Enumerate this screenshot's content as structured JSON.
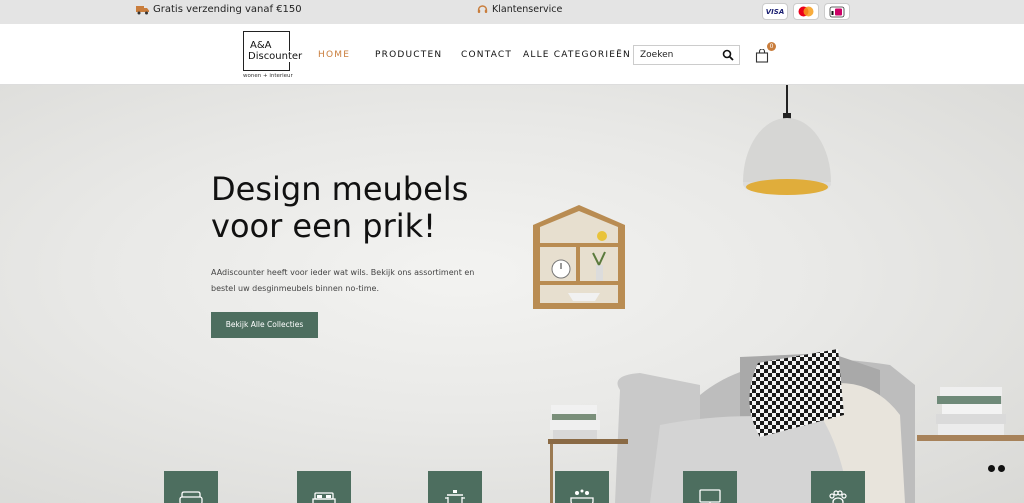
{
  "topbar": {
    "shipping_text": "Gratis verzending vanaf €150",
    "service_text": "Klantenservice",
    "payments": [
      "visa",
      "mastercard",
      "ideal"
    ],
    "visa_label": "VISA"
  },
  "logo": {
    "line1": "A&A",
    "line2": "Discounter",
    "tagline": "wonen + interieur"
  },
  "nav": {
    "items": [
      {
        "label": "HOME",
        "active": true
      },
      {
        "label": "PRODUCTEN",
        "active": false
      },
      {
        "label": "CONTACT",
        "active": false
      },
      {
        "label": "ALLE CATEGORIEËN",
        "active": false
      }
    ]
  },
  "search": {
    "placeholder": "Zoeken"
  },
  "cart": {
    "count": "0"
  },
  "hero": {
    "title": "Design meubels voor een prik!",
    "subtitle": "AAdiscounter heeft voor ieder wat wils. Bekijk ons assortiment en bestel uw desginmeubels binnen no-time.",
    "cta_label": "Bekijk Alle Collecties"
  },
  "categories": [
    {
      "icon": "sofa-icon"
    },
    {
      "icon": "bed-icon"
    },
    {
      "icon": "cooking-pot-icon"
    },
    {
      "icon": "bathtub-icon"
    },
    {
      "icon": "monitor-icon"
    },
    {
      "icon": "paw-icon"
    }
  ],
  "colors": {
    "accent": "#c97d3c",
    "brand_green": "#4d6e5f",
    "lamp_yellow": "#e0ad3b"
  }
}
